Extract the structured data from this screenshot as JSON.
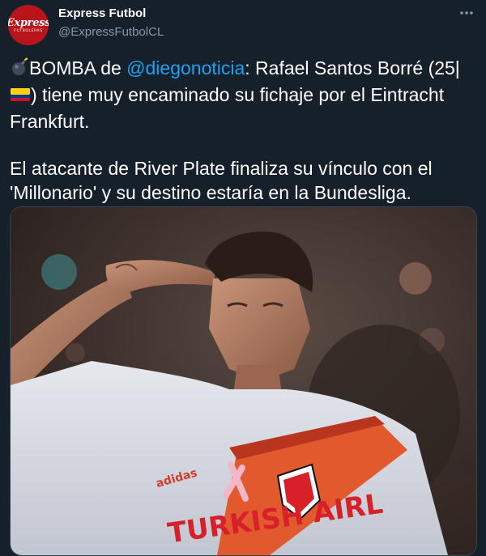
{
  "account": {
    "display_name": "Express Futbol",
    "handle": "@ExpressFutbolCL",
    "avatar_logo_main": "Express",
    "avatar_logo_sub": "FUTBOLERAS"
  },
  "tweet": {
    "line1_prefix": "BOMBA de ",
    "mention": "@diegonoticia",
    "line1_suffix": ": Rafael Santos Borré (25|",
    "line2": ") tiene muy encaminado su fichaje por el Eintracht Frankfurt.",
    "paragraph2": "El atacante de River Plate finaliza su vínculo con el 'Millonario' y su destino estaría en la Bundesliga."
  },
  "media": {
    "shirt_brand": "adidas",
    "shirt_sponsor": "TURKISH AIRL"
  },
  "icons": {
    "bomb": "bomb-icon",
    "flag": "colombia-flag-icon",
    "more": "more-icon"
  }
}
